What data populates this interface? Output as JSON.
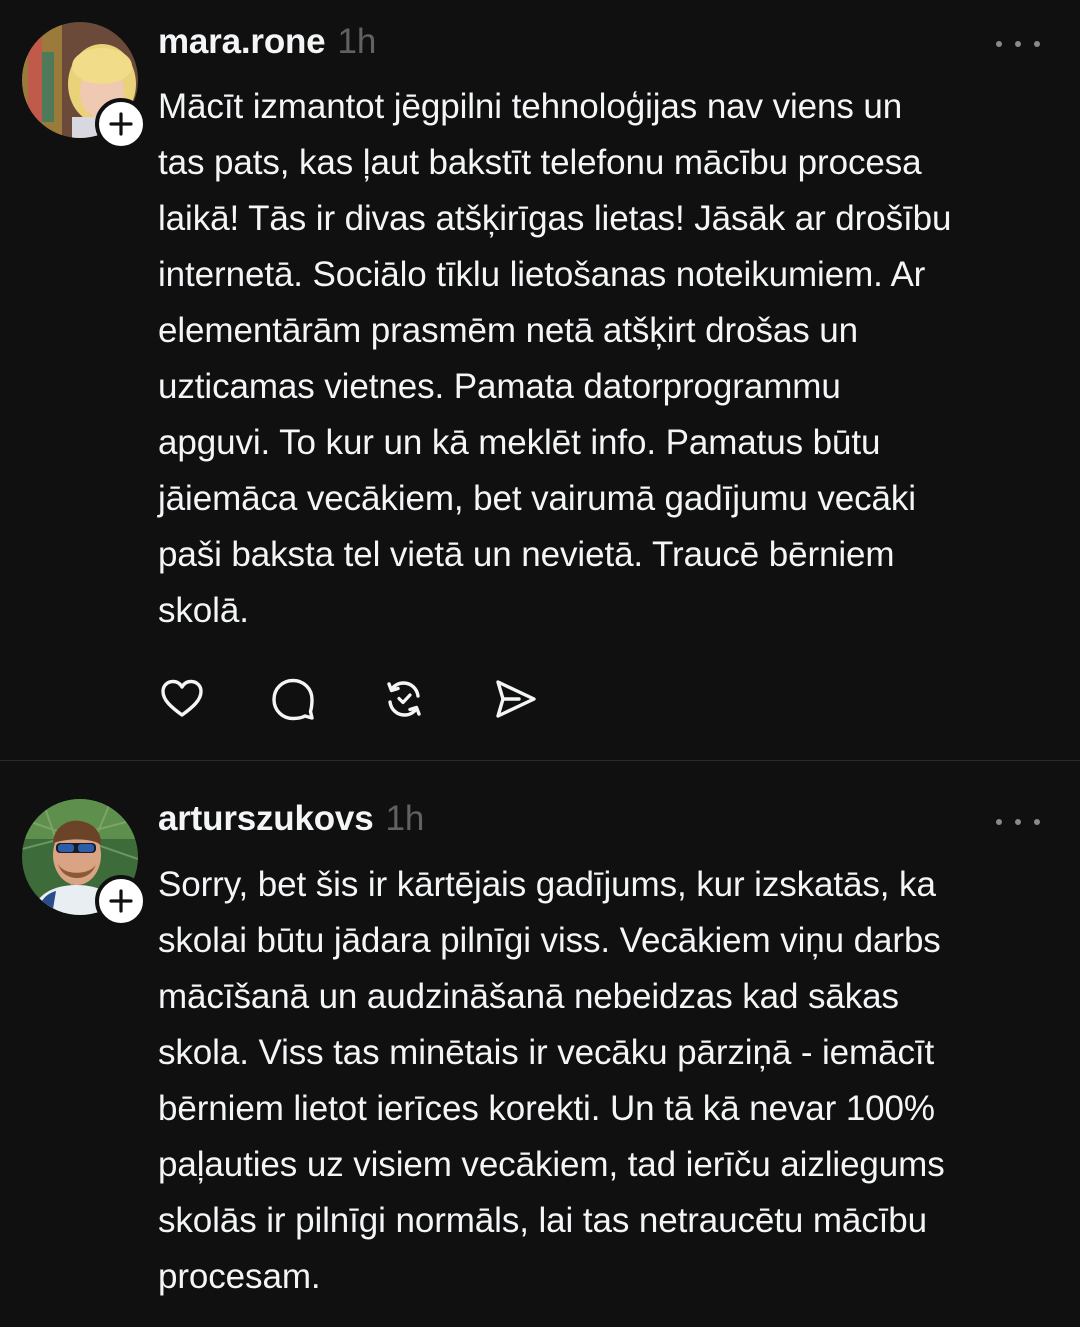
{
  "posts": [
    {
      "username": "mara.rone",
      "time": "1h",
      "text": "Mācīt izmantot jēgpilni tehnoloģijas nav viens un\ntas pats, kas ļaut bakstīt telefonu mācību procesa\nlaikā! Tās ir divas atšķirīgas lietas! Jāsāk ar drošību\ninternetā. Sociālo tīklu lietošanas noteikumiem. Ar\nelementārām prasmēm netā atšķirt drošas un\nuzticamas vietnes. Pamata datorprogrammu\napguvi. To kur un kā meklēt info. Pamatus būtu\njāiemāca vecākiem, bet vairumā gadījumu vecāki\npaši baksta tel vietā un nevietā. Traucē bērniem\nskolā.",
      "avatar_icon": "avatar-photo-blonde-woman",
      "follow_icon": "plus-icon",
      "actions": [
        "heart-icon",
        "comment-icon",
        "repost-icon",
        "share-icon"
      ]
    },
    {
      "username": "arturszukovs",
      "time": "1h",
      "text": "Sorry, bet šis ir kārtējais gadījums, kur izskatās, ka\nskolai būtu jādara pilnīgi viss. Vecākiem viņu darbs\nmācīšanā un audzināšanā nebeidzas kad sākas\nskola. Viss tas minētais ir vecāku pārziņā - iemācīt\nbērniem lietot ierīces korekti. Un tā kā nevar 100%\npaļauties uz visiem vecākiem, tad ierīču aizliegums\nskolās ir pilnīgi normāls, lai tas netraucētu mācību\nprocesam.",
      "avatar_icon": "avatar-photo-bearded-man-sunglasses",
      "follow_icon": "plus-icon"
    }
  ],
  "colors": {
    "background": "#101010",
    "text": "#f3f5f7",
    "muted": "#616161",
    "divider": "#2a2a2a"
  }
}
